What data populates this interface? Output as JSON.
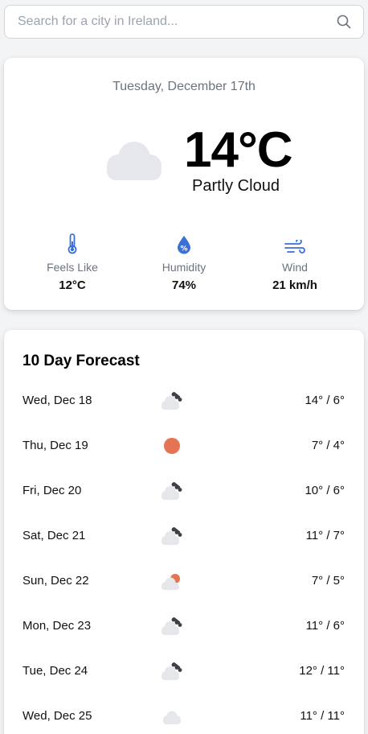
{
  "search": {
    "placeholder": "Search for a city in Ireland..."
  },
  "current": {
    "date": "Tuesday, December 17th",
    "temperature": "14°C",
    "condition": "Partly Cloud",
    "icon": "cloud",
    "stats": [
      {
        "label": "Feels Like",
        "value": "12°C",
        "icon": "thermometer"
      },
      {
        "label": "Humidity",
        "value": "74%",
        "icon": "droplet-percent"
      },
      {
        "label": "Wind",
        "value": "21 km/h",
        "icon": "wind"
      }
    ]
  },
  "forecast": {
    "title": "10 Day Forecast",
    "days": [
      {
        "day": "Wed, Dec 18",
        "icon": "rain-cloud",
        "range": "14° / 6°"
      },
      {
        "day": "Thu, Dec 19",
        "icon": "sun",
        "range": "7° / 4°"
      },
      {
        "day": "Fri, Dec 20",
        "icon": "rain-cloud",
        "range": "10° / 6°"
      },
      {
        "day": "Sat, Dec 21",
        "icon": "rain-cloud",
        "range": "11° / 7°"
      },
      {
        "day": "Sun, Dec 22",
        "icon": "partly-sunny",
        "range": "7° / 5°"
      },
      {
        "day": "Mon, Dec 23",
        "icon": "rain-cloud",
        "range": "11° / 6°"
      },
      {
        "day": "Tue, Dec 24",
        "icon": "rain-cloud",
        "range": "12° / 11°"
      },
      {
        "day": "Wed, Dec 25",
        "icon": "cloud",
        "range": "11° / 11°"
      }
    ]
  },
  "colors": {
    "accent_blue": "#3b6fd8",
    "sun_orange": "#e57452",
    "cloud_gray": "#e5e7eb",
    "rain_dark": "#3f3f46"
  }
}
